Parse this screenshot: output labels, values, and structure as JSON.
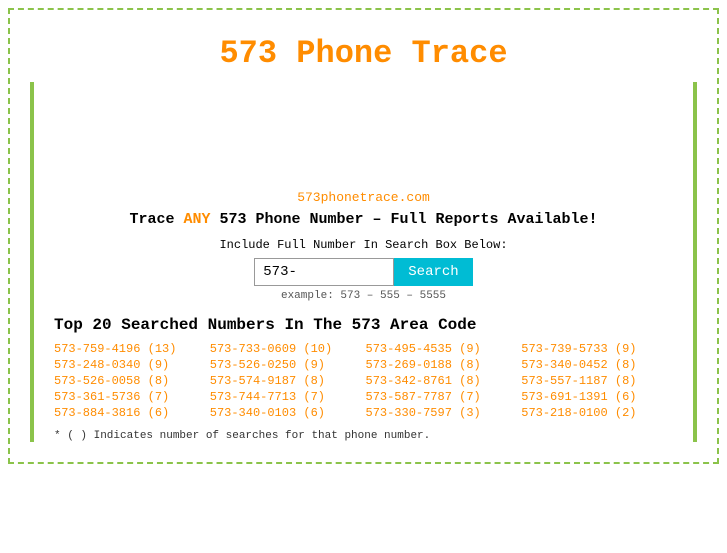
{
  "header": {
    "title": "573 Phone Trace"
  },
  "site_url": "573phonetrace.com",
  "tagline": {
    "prefix": "Trace ",
    "highlight": "ANY",
    "suffix": " 573 Phone Number – Full Reports Available!"
  },
  "search": {
    "label": "Include Full Number In Search Box Below:",
    "placeholder": "573-",
    "button_label": "Search",
    "example": "example: 573 – 555 – 5555"
  },
  "numbers_section": {
    "title": "Top 20 Searched Numbers In The 573 Area Code",
    "numbers": [
      "573-759-4196 (13)",
      "573-733-0609 (10)",
      "573-495-4535 (9)",
      "573-739-5733 (9)",
      "573-248-0340 (9)",
      "573-526-0250 (9)",
      "573-269-0188 (8)",
      "573-340-0452 (8)",
      "573-526-0058 (8)",
      "573-574-9187 (8)",
      "573-342-8761 (8)",
      "573-557-1187 (8)",
      "573-361-5736 (7)",
      "573-744-7713 (7)",
      "573-587-7787 (7)",
      "573-691-1391 (6)",
      "573-884-3816 (6)",
      "573-340-0103 (6)",
      "573-330-7597 (3)",
      "573-218-0100 (2)"
    ]
  },
  "footnote": "* ( ) Indicates number of searches for that phone number."
}
